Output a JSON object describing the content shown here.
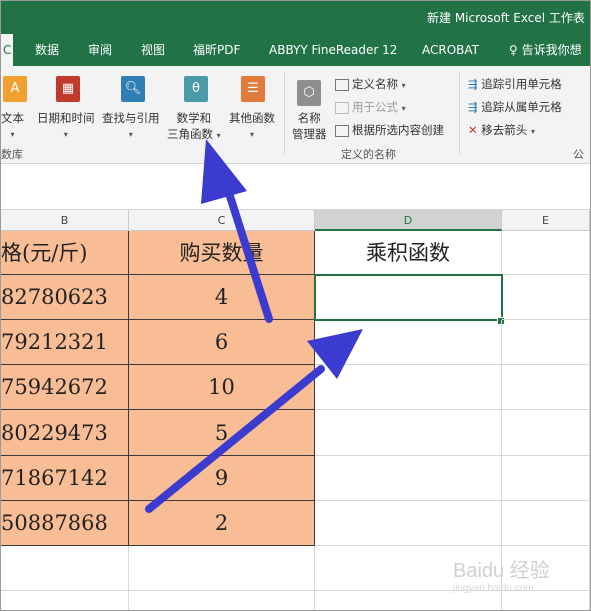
{
  "window": {
    "title": "新建 Microsoft Excel 工作表"
  },
  "tabs": [
    {
      "label": "C",
      "active": true
    },
    {
      "label": "数据"
    },
    {
      "label": "审阅"
    },
    {
      "label": "视图"
    },
    {
      "label": "福昕PDF"
    },
    {
      "label": "ABBYY FineReader 12"
    },
    {
      "label": "ACROBAT"
    },
    {
      "label": "告诉我你想"
    }
  ],
  "ribbon": {
    "function_library": {
      "text_label": "文本",
      "datetime_label": "日期和时间",
      "lookup_label": "查找与引用",
      "math_line1": "数学和",
      "math_line2": "三角函数",
      "other_label": "其他函数",
      "group_label": "数库"
    },
    "defined_names": {
      "name_manager_line1": "名称",
      "name_manager_line2": "管理器",
      "define_name": "定义名称",
      "use_in_formula": "用于公式",
      "create_from_selection": "根据所选内容创建",
      "group_label": "定义的名称"
    },
    "formula_auditing": {
      "trace_precedents": "追踪引用单元格",
      "trace_dependents": "追踪从属单元格",
      "remove_arrows": "移去箭头",
      "group_label_partial": "公"
    }
  },
  "columns": [
    "B",
    "C",
    "D",
    "E"
  ],
  "table": {
    "headers": {
      "B": "格(元/斤)",
      "C": "购买数量",
      "D": "乘积函数"
    },
    "rows": [
      {
        "B": "82780623",
        "C": "4"
      },
      {
        "B": "79212321",
        "C": "6"
      },
      {
        "B": "75942672",
        "C": "10"
      },
      {
        "B": "80229473",
        "C": "5"
      },
      {
        "B": "71867142",
        "C": "9"
      },
      {
        "B": "50887868",
        "C": "2"
      }
    ]
  },
  "colors": {
    "excel_green": "#217346",
    "cell_orange": "#f8bd95",
    "arrow_blue": "#3b3bd0"
  },
  "watermark": {
    "text": "Baidu 经验",
    "sub": "jingyan.baidu.com"
  }
}
